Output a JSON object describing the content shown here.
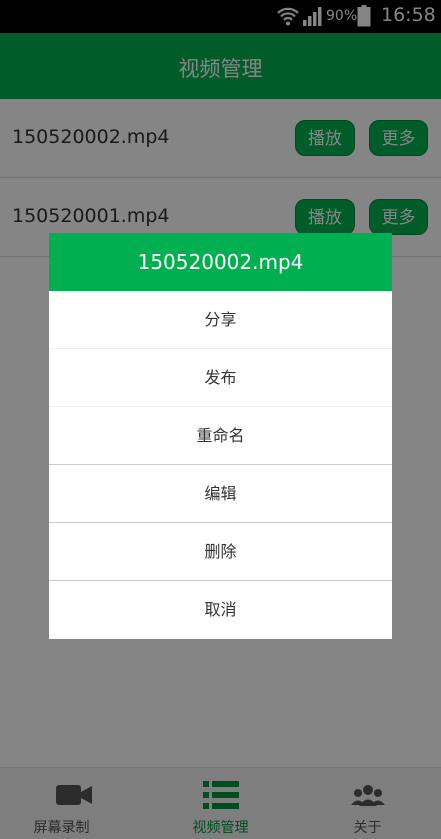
{
  "status_bar": {
    "battery_percent": "90%",
    "time": "16:58"
  },
  "header": {
    "title": "视频管理"
  },
  "videos": [
    {
      "file_name": "150520002.mp4",
      "play_label": "播放",
      "more_label": "更多"
    },
    {
      "file_name": "150520001.mp4",
      "play_label": "播放",
      "more_label": "更多"
    }
  ],
  "dialog": {
    "title": "150520002.mp4",
    "items": [
      "分享",
      "发布",
      "重命名",
      "编辑",
      "删除",
      "取消"
    ]
  },
  "bottom_nav": [
    {
      "label": "屏幕录制",
      "icon": "video-camera-icon",
      "active": false
    },
    {
      "label": "视频管理",
      "icon": "list-icon",
      "active": true
    },
    {
      "label": "关于",
      "icon": "people-icon",
      "active": false
    }
  ],
  "colors": {
    "accent": "#00b050",
    "overlay": "rgba(0,0,0,0.48)"
  }
}
